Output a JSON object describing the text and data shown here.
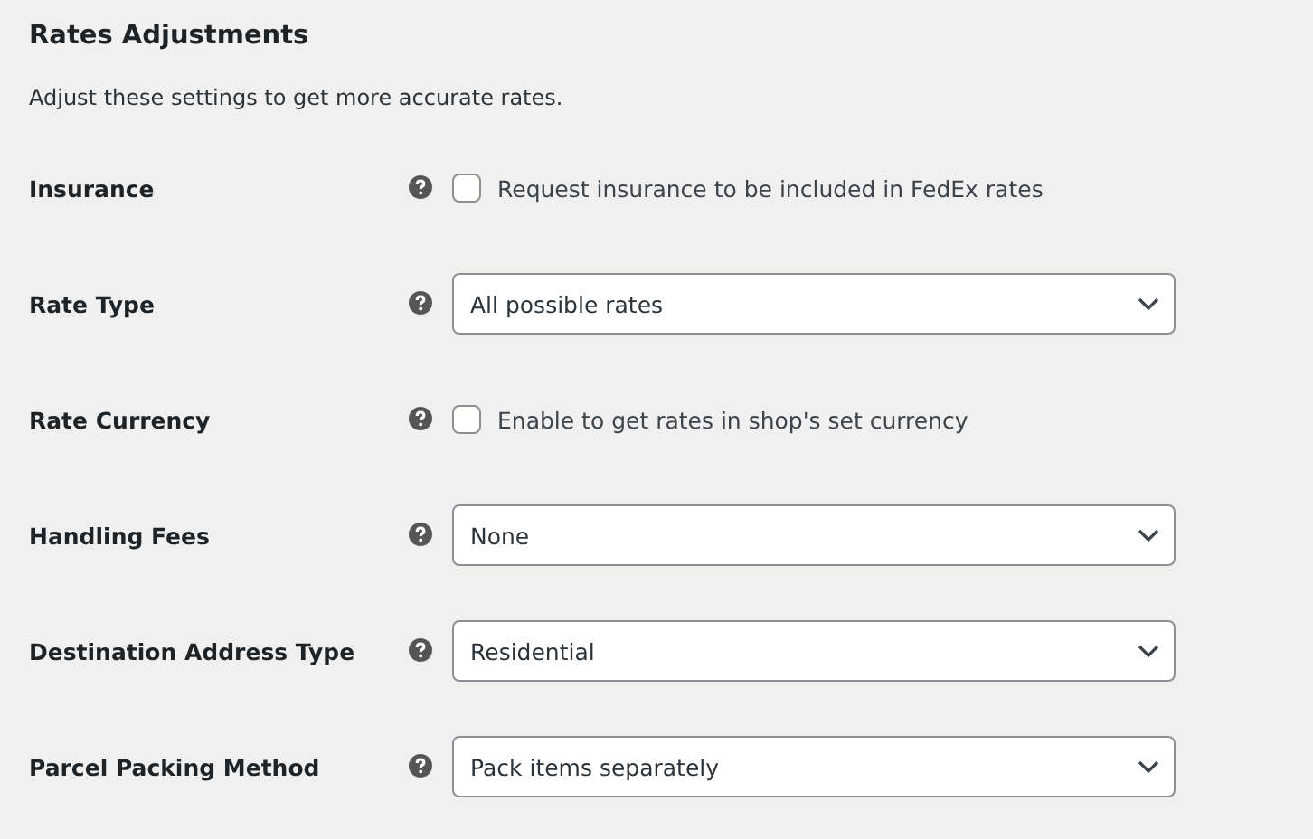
{
  "title": "Rates Adjustments",
  "description": "Adjust these settings to get more accurate rates.",
  "settings": [
    {
      "label": "Insurance",
      "kind": "checkbox",
      "checked": false,
      "text": "Request insurance to be included in FedEx rates"
    },
    {
      "label": "Rate Type",
      "kind": "select",
      "value": "All possible rates"
    },
    {
      "label": "Rate Currency",
      "kind": "checkbox",
      "checked": false,
      "text": "Enable to get rates in shop's set currency"
    },
    {
      "label": "Handling Fees",
      "kind": "select",
      "value": "None"
    },
    {
      "label": "Destination Address Type",
      "kind": "select",
      "value": "Residential"
    },
    {
      "label": "Parcel Packing Method",
      "kind": "select",
      "value": "Pack items separately"
    }
  ]
}
